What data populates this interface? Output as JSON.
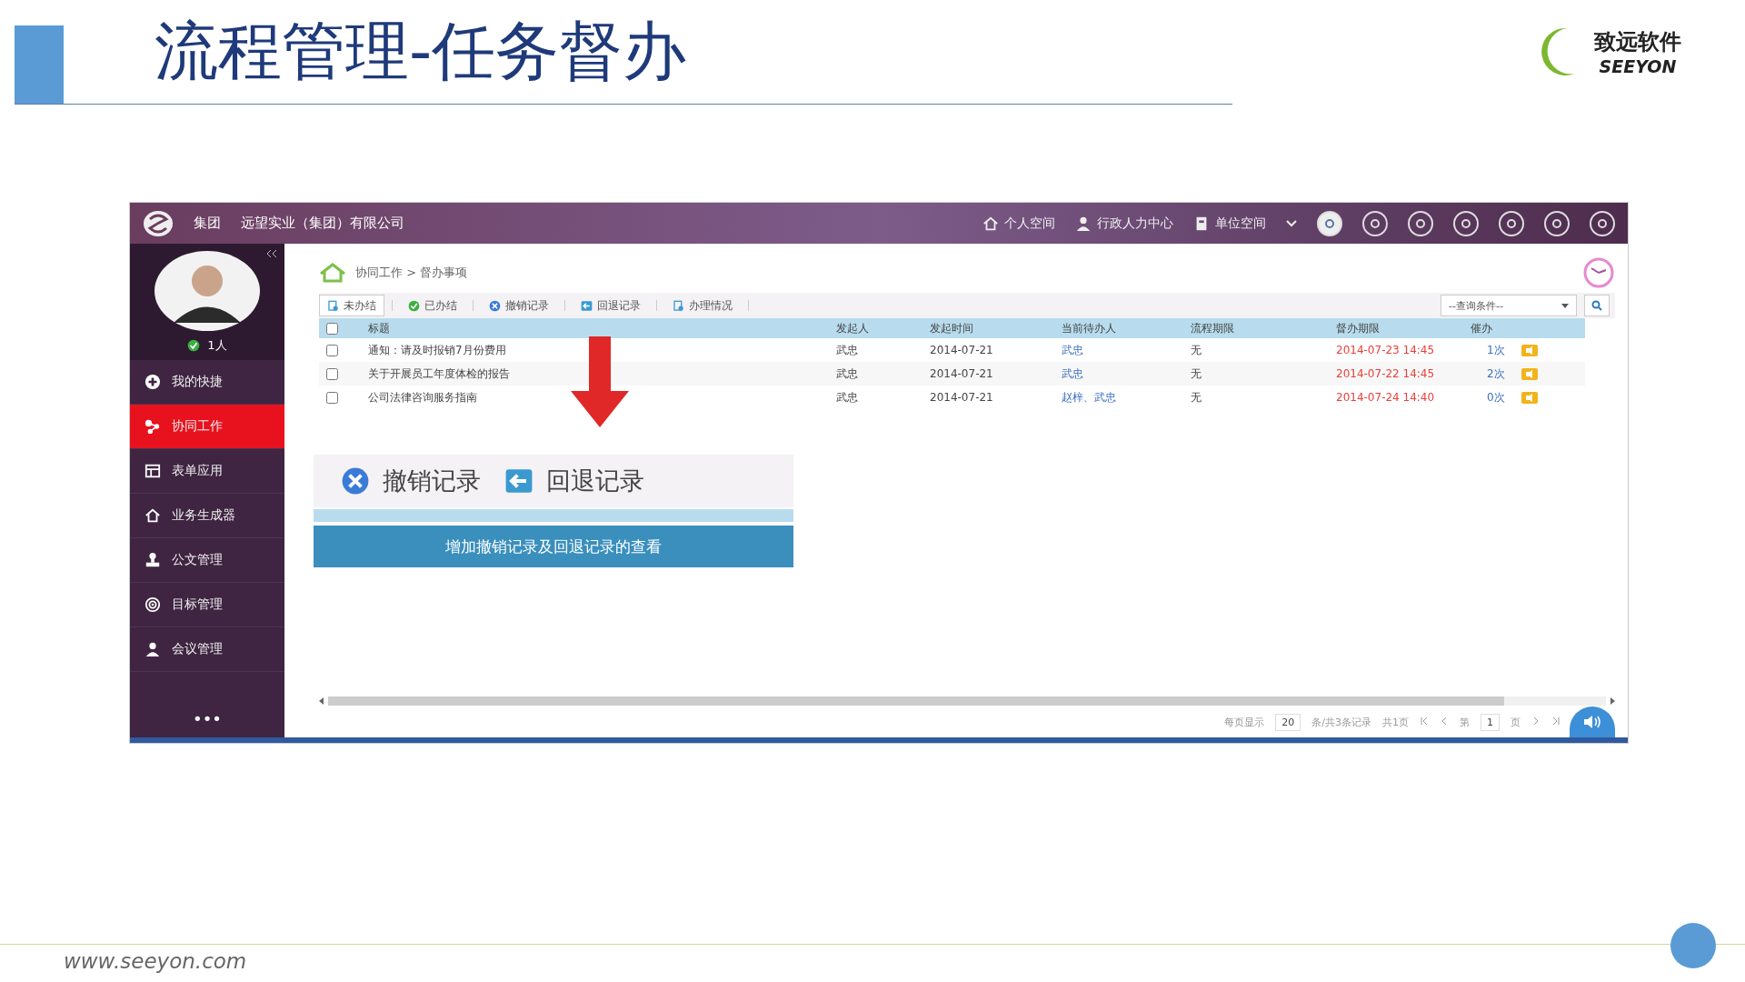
{
  "slide": {
    "title": "流程管理-任务督办",
    "footer_url": "www.seeyon.com",
    "logo": {
      "name": "致远软件",
      "latin": "SEEYON"
    }
  },
  "app": {
    "topbar": {
      "group": "集团",
      "company": "远望实业（集团）有限公司",
      "nav": [
        {
          "label": "个人空间",
          "kind": "home"
        },
        {
          "label": "行政人力中心",
          "kind": "people"
        },
        {
          "label": "单位空间",
          "kind": "building"
        }
      ]
    },
    "sidebar": {
      "user_count": "1人",
      "items": [
        {
          "label": "我的快捷",
          "selected": false,
          "kind": "plus"
        },
        {
          "label": "协同工作",
          "selected": true,
          "kind": "share"
        },
        {
          "label": "表单应用",
          "selected": false,
          "kind": "form"
        },
        {
          "label": "业务生成器",
          "selected": false,
          "kind": "house"
        },
        {
          "label": "公文管理",
          "selected": false,
          "kind": "stamp"
        },
        {
          "label": "目标管理",
          "selected": false,
          "kind": "target"
        },
        {
          "label": "会议管理",
          "selected": false,
          "kind": "person"
        }
      ],
      "more": "•••"
    },
    "breadcrumb": "协同工作 > 督办事项",
    "tabs": [
      {
        "label": "未办结",
        "selected": true,
        "kind": "doc"
      },
      {
        "label": "已办结",
        "selected": false,
        "kind": "check"
      },
      {
        "label": "撤销记录",
        "selected": false,
        "kind": "cancel"
      },
      {
        "label": "回退记录",
        "selected": false,
        "kind": "back"
      },
      {
        "label": "办理情况",
        "selected": false,
        "kind": "doc"
      }
    ],
    "query_select": {
      "value": "--查询条件--"
    },
    "table": {
      "select_all_checked": false,
      "columns": [
        "标题",
        "发起人",
        "发起时间",
        "当前待办人",
        "流程期限",
        "督办期限",
        "催办"
      ],
      "rows": [
        {
          "checked": false,
          "title": "通知：请及时报销7月份费用",
          "sender": "武忠",
          "sent": "2014-07-21",
          "assignee": "武忠",
          "flow_limit": "无",
          "due": "2014-07-23 14:45",
          "reminders": "1次"
        },
        {
          "checked": false,
          "title": "关于开展员工年度体检的报告",
          "sender": "武忠",
          "sent": "2014-07-21",
          "assignee": "武忠",
          "flow_limit": "无",
          "due": "2014-07-22 14:45",
          "reminders": "2次"
        },
        {
          "checked": false,
          "title": "公司法律咨询服务指南",
          "sender": "武忠",
          "sent": "2014-07-21",
          "assignee": "赵梓、武忠",
          "flow_limit": "无",
          "due": "2014-07-24 14:40",
          "reminders": "0次"
        }
      ]
    },
    "pagination": {
      "per_page_label": "每页显示",
      "per_page": "20",
      "summary": "条/共3条记录",
      "pages": "共1页",
      "page_label": "第",
      "page": "1",
      "page_unit": "页"
    }
  },
  "callout": {
    "tabs": [
      {
        "label": "撤销记录",
        "kind": "cancel"
      },
      {
        "label": "回退记录",
        "kind": "back"
      }
    ],
    "caption": "增加撤销记录及回退记录的查看"
  }
}
